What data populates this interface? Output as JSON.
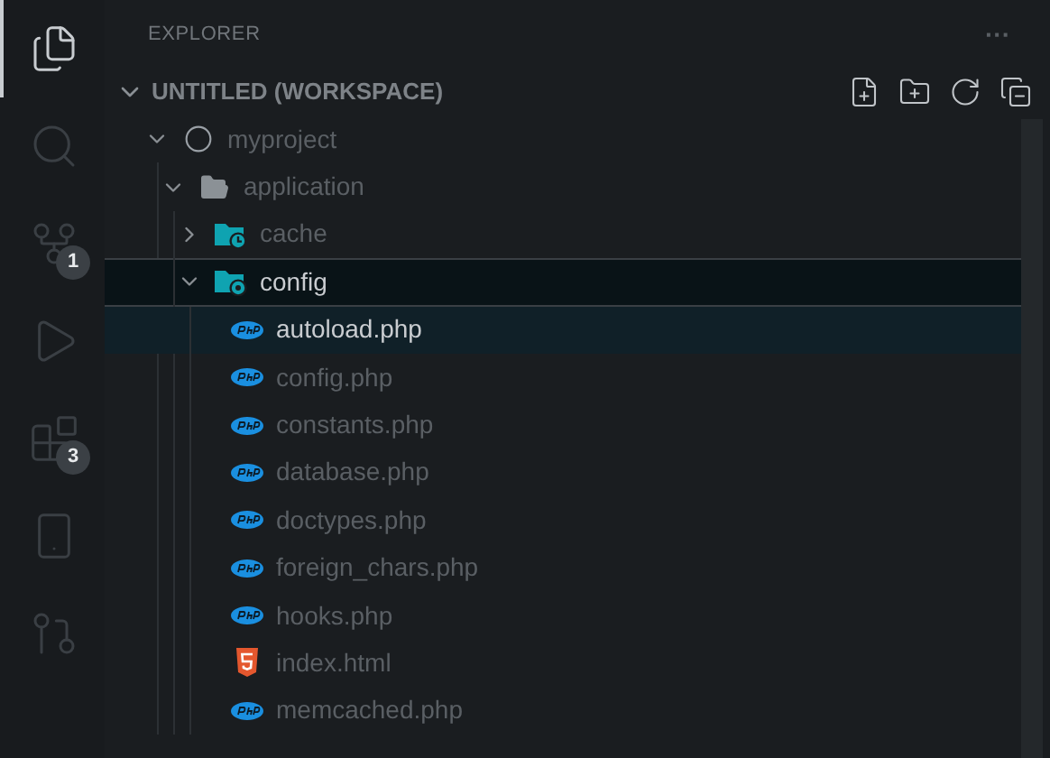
{
  "activity_bar": [
    {
      "kind": "files",
      "selected": true
    },
    {
      "kind": "search",
      "selected": false
    },
    {
      "kind": "source-control",
      "selected": false,
      "badge": "1"
    },
    {
      "kind": "run",
      "selected": false
    },
    {
      "kind": "extensions",
      "selected": false,
      "badge": "3"
    },
    {
      "kind": "device",
      "selected": false
    },
    {
      "kind": "git",
      "selected": false
    }
  ],
  "explorer": {
    "title": "EXPLORER",
    "more": "···",
    "workspace": {
      "label": "UNTITLED (WORKSPACE)",
      "expanded": true,
      "actions": [
        {
          "kind": "new-file"
        },
        {
          "kind": "new-folder"
        },
        {
          "kind": "refresh"
        },
        {
          "kind": "collapse"
        }
      ],
      "children": [
        {
          "label": "myproject",
          "kind": "root",
          "expanded": true,
          "selected": false,
          "focused": false,
          "children": [
            {
              "label": "application",
              "kind": "folder",
              "expanded": true,
              "selected": false,
              "focused": false,
              "children": [
                {
                  "label": "cache",
                  "kind": "cache-folder",
                  "expanded": false,
                  "selected": false,
                  "focused": false
                },
                {
                  "label": "config",
                  "kind": "config-folder",
                  "expanded": true,
                  "selected": false,
                  "focused": true,
                  "children": [
                    {
                      "label": "autoload.php",
                      "kind": "php",
                      "selected": true,
                      "focused": false
                    },
                    {
                      "label": "config.php",
                      "kind": "php",
                      "selected": false,
                      "focused": false
                    },
                    {
                      "label": "constants.php",
                      "kind": "php",
                      "selected": false,
                      "focused": false
                    },
                    {
                      "label": "database.php",
                      "kind": "php",
                      "selected": false,
                      "focused": false
                    },
                    {
                      "label": "doctypes.php",
                      "kind": "php",
                      "selected": false,
                      "focused": false
                    },
                    {
                      "label": "foreign_chars.php",
                      "kind": "php",
                      "selected": false,
                      "focused": false
                    },
                    {
                      "label": "hooks.php",
                      "kind": "php",
                      "selected": false,
                      "focused": false
                    },
                    {
                      "label": "index.html",
                      "kind": "html",
                      "selected": false,
                      "focused": false
                    },
                    {
                      "label": "memcached.php",
                      "kind": "php",
                      "selected": false,
                      "focused": false
                    }
                  ]
                }
              ]
            }
          ]
        }
      ]
    }
  }
}
